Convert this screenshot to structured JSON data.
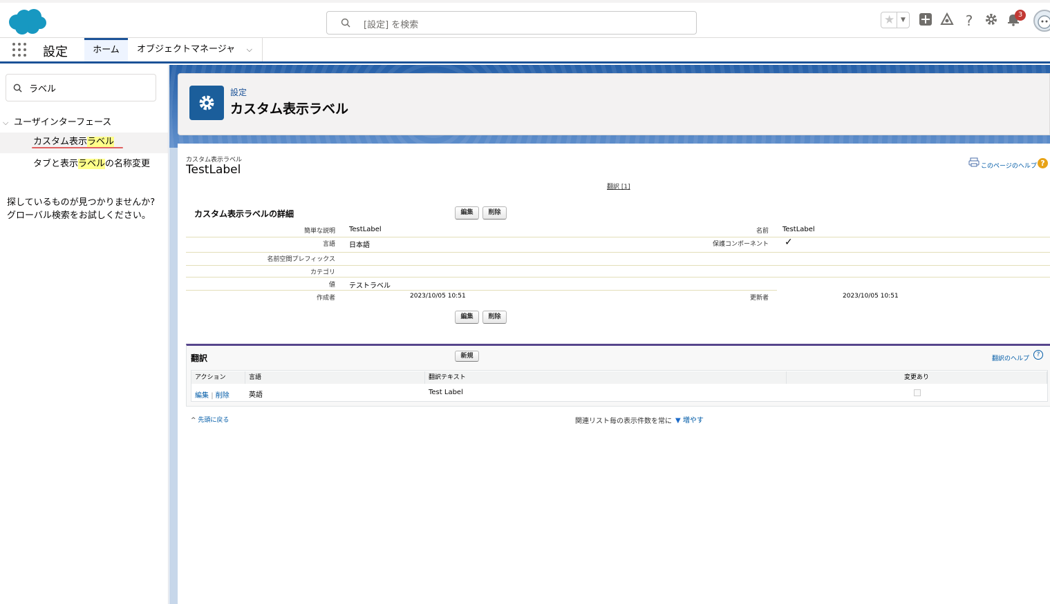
{
  "header": {
    "search_placeholder": "[設定] を検索",
    "notification_count": "3"
  },
  "nav": {
    "app_name": "設定",
    "tabs": [
      {
        "label": "ホーム"
      },
      {
        "label": "オブジェクトマネージャ"
      }
    ]
  },
  "sidebar": {
    "search_value": "ラベル",
    "section": "ユーザインターフェース",
    "item1": {
      "pre": "カスタム表示",
      "hl": "ラベル",
      "post": ""
    },
    "item2": {
      "pre": "タブと表示",
      "hl": "ラベル",
      "post": "の名称変更"
    },
    "note_line1": "探しているものが見つかりませんか?",
    "note_line2": "グローバル検索をお試しください。"
  },
  "page_header": {
    "eyebrow": "設定",
    "title": "カスタム表示ラベル"
  },
  "record": {
    "type_label": "カスタム表示ラベル",
    "name": "TestLabel",
    "help_link": "このページのヘルプ",
    "translation_jump": "翻訳 [1]",
    "detail_title": "カスタム表示ラベルの詳細",
    "edit_btn": "編集",
    "delete_btn": "削除",
    "fields": {
      "short_desc_label": "簡単な説明",
      "short_desc_value": "TestLabel",
      "name_label": "名前",
      "name_value": "TestLabel",
      "language_label": "言語",
      "language_value": "日本語",
      "protected_label": "保護コンポーネント",
      "protected_value": "✓",
      "namespace_label": "名前空間プレフィックス",
      "category_label": "カテゴリ",
      "value_label": "値",
      "value_value": "テストラベル",
      "created_label": "作成者",
      "created_value": "2023/10/05 10:51",
      "modified_label": "更新者",
      "modified_value": "2023/10/05 10:51"
    }
  },
  "translations": {
    "title": "翻訳",
    "new_btn": "新規",
    "help_link": "翻訳のヘルプ",
    "columns": [
      "アクション",
      "言語",
      "翻訳テキスト",
      "変更あり"
    ],
    "rows": [
      {
        "edit": "編集",
        "delete": "削除",
        "language": "英語",
        "text": "Test Label",
        "changed": false
      }
    ]
  },
  "footer": {
    "back_to_top": "先頭に戻る",
    "related_list_text": "関連リスト毎の表示件数を常に",
    "more_link": "増やす"
  },
  "colors": {
    "brand": "#1b5297",
    "header_icon": "#1b5e9b",
    "badge": "#c23934",
    "highlight": "#ffff8a"
  }
}
